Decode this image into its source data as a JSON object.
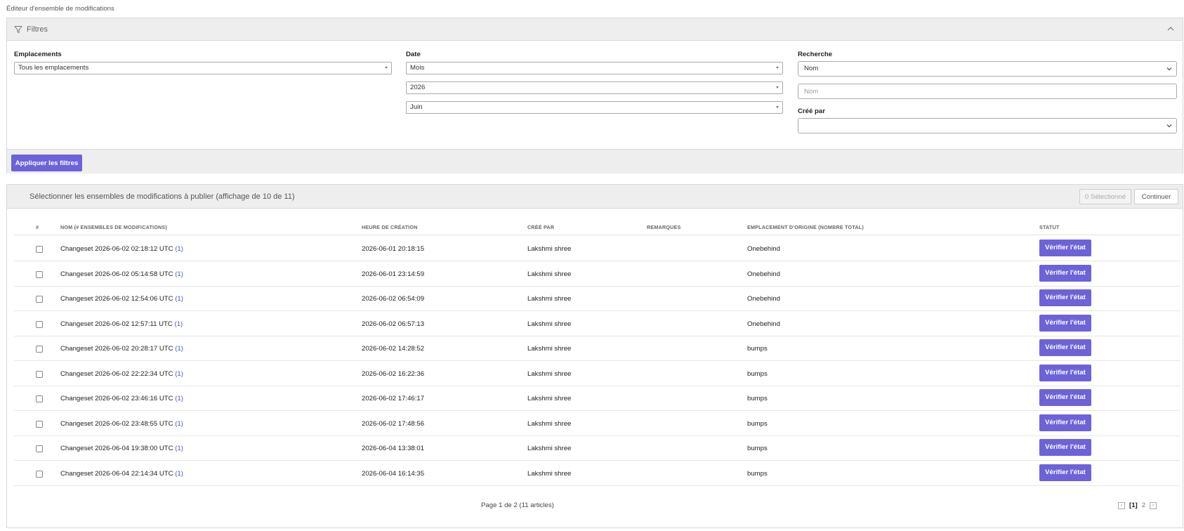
{
  "page": {
    "title": "Éditeur d'ensemble de modifications"
  },
  "filters": {
    "title": "Filtres",
    "locations": {
      "label": "Emplacements",
      "value": "Tous les emplacements"
    },
    "date": {
      "label": "Date",
      "period": "Mois",
      "year": "2026",
      "month": "Juin"
    },
    "search": {
      "label": "Recherche",
      "field": "Nom",
      "placeholder": "Nom"
    },
    "created_by": {
      "label": "Créé par",
      "value": ""
    },
    "apply_label": "Appliquer les filtres"
  },
  "results": {
    "title": "Sélectionner les ensembles de modifications à publier (affichage de 10 de 11)",
    "selected_label": "0 Sélectionné",
    "continue_label": "Continuer",
    "columns": [
      "#",
      "NOM (# ENSEMBLES DE MODIFICATIONS)",
      "HEURE DE CRÉATION",
      "CRÉÉ PAR",
      "REMARQUES",
      "EMPLACEMENT D'ORIGINE (NOMBRE TOTAL)",
      "STATUT"
    ],
    "rows": [
      {
        "name": "Changeset 2026-06-02 02:18:12 UTC",
        "count": "(1)",
        "created": "2026-06-01 20:18:15",
        "author": "Lakshmi shree",
        "remarks": "",
        "origin": "Onebehind",
        "status": "Vérifier l'état"
      },
      {
        "name": "Changeset 2026-06-02 05:14:58 UTC",
        "count": "(1)",
        "created": "2026-06-01 23:14:59",
        "author": "Lakshmi shree",
        "remarks": "",
        "origin": "Onebehind",
        "status": "Vérifier l'état"
      },
      {
        "name": "Changeset 2026-06-02 12:54:06 UTC",
        "count": "(1)",
        "created": "2026-06-02 06:54:09",
        "author": "Lakshmi shree",
        "remarks": "",
        "origin": "Onebehind",
        "status": "Vérifier l'état"
      },
      {
        "name": "Changeset 2026-06-02 12:57:11 UTC",
        "count": "(1)",
        "created": "2026-06-02 06:57:13",
        "author": "Lakshmi shree",
        "remarks": "",
        "origin": "Onebehind",
        "status": "Vérifier l'état"
      },
      {
        "name": "Changeset 2026-06-02 20:28:17 UTC",
        "count": "(1)",
        "created": "2026-06-02 14:28:52",
        "author": "Lakshmi shree",
        "remarks": "",
        "origin": "bumps",
        "status": "Vérifier l'état"
      },
      {
        "name": "Changeset 2026-06-02 22:22:34 UTC",
        "count": "(1)",
        "created": "2026-06-02 16:22:36",
        "author": "Lakshmi shree",
        "remarks": "",
        "origin": "bumps",
        "status": "Vérifier l'état"
      },
      {
        "name": "Changeset 2026-06-02 23:46:16 UTC",
        "count": "(1)",
        "created": "2026-06-02 17:46:17",
        "author": "Lakshmi shree",
        "remarks": "",
        "origin": "bumps",
        "status": "Vérifier l'état"
      },
      {
        "name": "Changeset 2026-06-02 23:48:55 UTC",
        "count": "(1)",
        "created": "2026-06-02 17:48:56",
        "author": "Lakshmi shree",
        "remarks": "",
        "origin": "bumps",
        "status": "Vérifier l'état"
      },
      {
        "name": "Changeset 2026-06-04 19:38:00 UTC",
        "count": "(1)",
        "created": "2026-06-04 13:38:01",
        "author": "Lakshmi shree",
        "remarks": "",
        "origin": "bumps",
        "status": "Vérifier l'état"
      },
      {
        "name": "Changeset 2026-06-04 22:14:34 UTC",
        "count": "(1)",
        "created": "2026-06-04 16:14:35",
        "author": "Lakshmi shree",
        "remarks": "",
        "origin": "bumps",
        "status": "Vérifier l'état"
      }
    ],
    "pager": {
      "summary": "Page 1 de 2 (11 articles)",
      "current": "[1]",
      "next": "2",
      "prev_icon": "chevron-left-icon",
      "next_icon": "chevron-right-icon"
    }
  },
  "colors": {
    "accent": "#6c63d8",
    "link": "#4a55c7",
    "panel_header": "#eeeeee"
  },
  "icons": {
    "filter": "filter-icon",
    "collapse": "chevron-up-icon",
    "select_caret": "caret-down-icon"
  }
}
